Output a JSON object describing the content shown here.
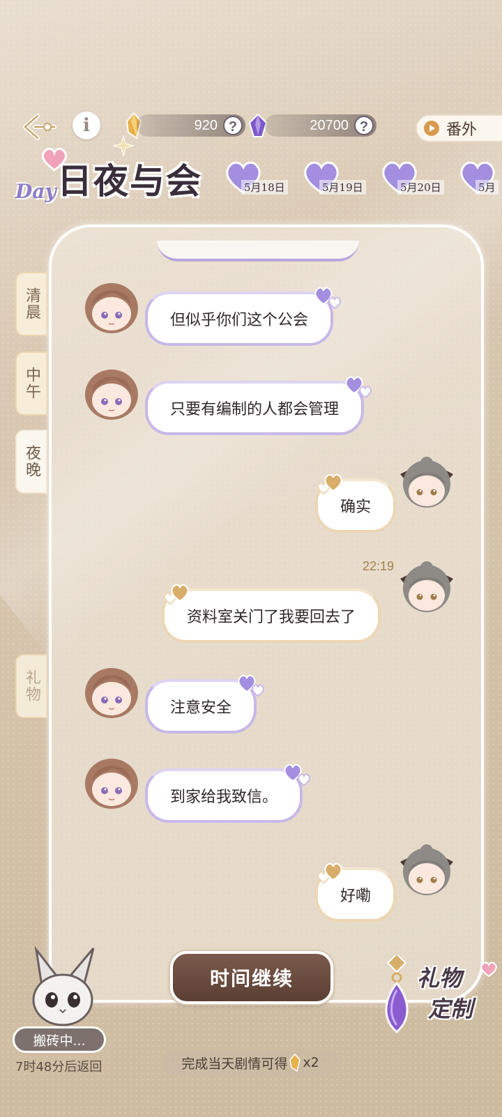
{
  "header": {
    "info_label": "i",
    "currency_amber": {
      "amount": "920",
      "help": "?"
    },
    "currency_violet": {
      "amount": "20700",
      "help": "?"
    },
    "extra_label": "番外"
  },
  "logo": {
    "title": "日夜与会",
    "day": "Day"
  },
  "dates": [
    {
      "label": "5月18日"
    },
    {
      "label": "5月19日"
    },
    {
      "label": "5月20日"
    },
    {
      "label": "5月"
    }
  ],
  "side_tabs": {
    "morning": "清晨",
    "noon": "中午",
    "night": "夜晚",
    "gift": "礼物"
  },
  "messages": [
    {
      "side": "left",
      "text": "但似乎你们这个公会"
    },
    {
      "side": "left",
      "text": "只要有编制的人都会管理"
    },
    {
      "side": "right",
      "text": "确实"
    },
    {
      "side": "right",
      "text": "资料室关门了我要回去了"
    },
    {
      "side": "left",
      "text": "注意安全"
    },
    {
      "side": "left",
      "text": "到家给我致信。"
    },
    {
      "side": "right",
      "text": "好嘞"
    }
  ],
  "timestamp": "22:19",
  "bottom": {
    "continue_label": "时间继续",
    "reward_text": "完成当天剧情可得",
    "reward_suffix": "x2",
    "pet_status": "搬砖中...",
    "pet_return": "7时48分后返回",
    "gift_custom_line1": "礼物",
    "gift_custom_line2": "定制"
  },
  "colors": {
    "left_bubble_border": "#c7b8e8",
    "right_bubble_border": "#ecd6b4",
    "continue_button": "#6a4c40",
    "timestamp": "#a58148"
  }
}
